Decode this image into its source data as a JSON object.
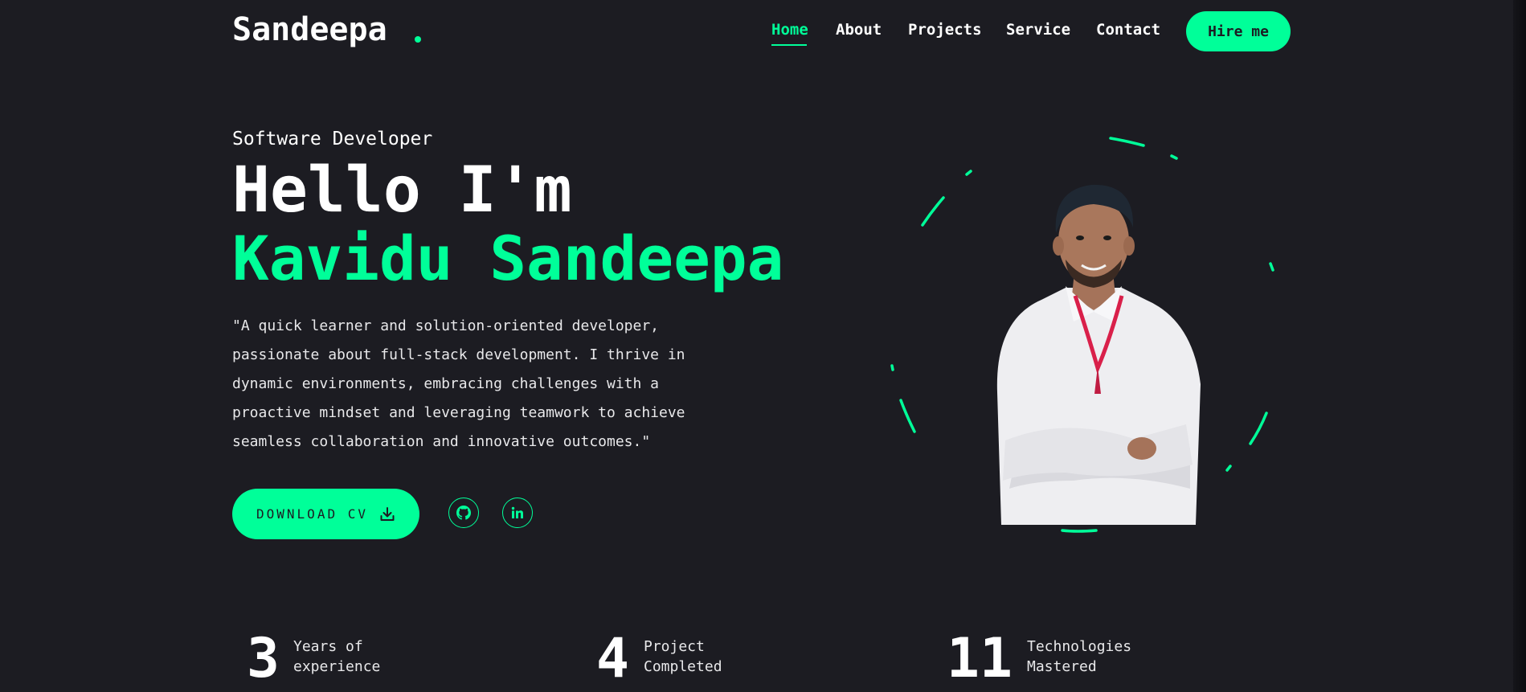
{
  "header": {
    "logo": "Sandeepa",
    "accent_color": "#00ff99",
    "nav": [
      {
        "label": "Home",
        "active": true
      },
      {
        "label": "About",
        "active": false
      },
      {
        "label": "Projects",
        "active": false
      },
      {
        "label": "Service",
        "active": false
      },
      {
        "label": "Contact",
        "active": false
      }
    ],
    "hire_label": "Hire me"
  },
  "hero": {
    "role": "Software Developer",
    "greeting": "Hello I'm",
    "name": "Kavidu Sandeepa",
    "bio_lines": [
      "\"A quick learner and solution-oriented developer,",
      "passionate about full-stack development. I thrive in",
      "dynamic environments, embracing challenges with a",
      "proactive mindset and leveraging teamwork to achieve",
      "seamless collaboration and innovative outcomes.\""
    ],
    "cv_label": "DOWNLOAD CV",
    "cv_icon": "download-icon",
    "socials": [
      {
        "icon": "github-icon"
      },
      {
        "icon": "linkedin-icon"
      }
    ]
  },
  "stats": [
    {
      "value": "3",
      "label_line1": "Years of",
      "label_line2": "experience"
    },
    {
      "value": "4",
      "label_line1": "Project",
      "label_line2": "Completed"
    },
    {
      "value": "11",
      "label_line1": "Technologies",
      "label_line2": "Mastered"
    }
  ],
  "colors": {
    "background": "#1c1c22",
    "accent": "#00ff99",
    "text": "#ffffff"
  }
}
